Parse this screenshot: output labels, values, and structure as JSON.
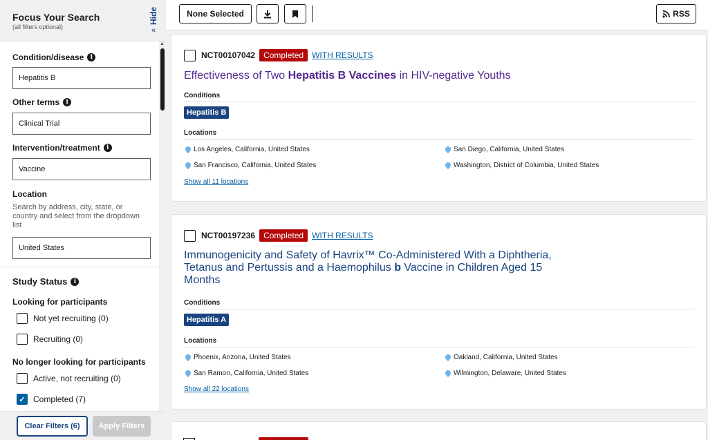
{
  "sidebar": {
    "title": "Focus Your Search",
    "subtitle": "(all filters optional)",
    "hide_label": "Hide",
    "hide_chevron": "«",
    "condition": {
      "label": "Condition/disease",
      "value": "Hepatitis B"
    },
    "other_terms": {
      "label": "Other terms",
      "value": "Clinical Trial"
    },
    "intervention": {
      "label": "Intervention/treatment",
      "value": "Vaccine"
    },
    "location": {
      "label": "Location",
      "hint": "Search by address, city, state, or country and select from the dropdown list",
      "value": "United States"
    },
    "study_status": {
      "title": "Study Status",
      "looking_label": "Looking for participants",
      "not_yet": "Not yet recruiting (0)",
      "recruiting": "Recruiting (0)",
      "no_longer_label": "No longer looking for participants",
      "active": "Active, not recruiting (0)",
      "completed": "Completed (7)"
    },
    "clear_filters": "Clear Filters (6)",
    "apply_filters": "Apply Filters"
  },
  "toolbar": {
    "none_selected": "None Selected",
    "rss": "RSS"
  },
  "results": [
    {
      "nct": "NCT00107042",
      "status": "Completed",
      "with_results": "WITH RESULTS",
      "title_pre": "Effectiveness of Two ",
      "title_bold": "Hepatitis B Vaccines",
      "title_post": " in HIV-negative Youths",
      "conditions_label": "Conditions",
      "condition": "Hepatitis B",
      "locations_label": "Locations",
      "locations": [
        "Los Angeles, California, United States",
        "San Diego, California, United States",
        "San Francisco, California, United States",
        "Washington, District of Columbia, United States"
      ],
      "show_all": "Show all 11 locations"
    },
    {
      "nct": "NCT00197236",
      "status": "Completed",
      "with_results": "WITH RESULTS",
      "title_pre": "Immunogenicity and Safety of Havrix™ Co-Administered With a Diphtheria, Tetanus and Pertussis and a Haemophilus ",
      "title_bold": "b",
      "title_post": " Vaccine in Children Aged 15 Months",
      "conditions_label": "Conditions",
      "condition": "Hepatitis A",
      "locations_label": "Locations",
      "locations": [
        "Phoenix, Arizona, United States",
        "Oakland, California, United States",
        "San Ramon, California, United States",
        "Wilmington, Delaware, United States"
      ],
      "show_all": "Show all 22 locations"
    }
  ],
  "colors": {
    "primary": "#1a4480",
    "completed_badge": "#b50909",
    "link": "#005ea2",
    "visited": "#54278f",
    "pin": "#73b3e7"
  }
}
